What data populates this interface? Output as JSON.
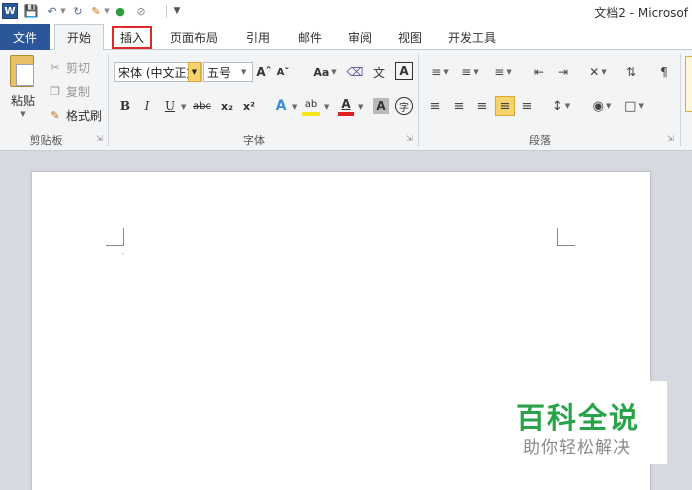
{
  "app": {
    "logo_letter": "W",
    "window_title": "文档2 - Microsof",
    "accent": "#2b579a",
    "highlight_box_color": "#e02828"
  },
  "quick_access": {
    "save_icon": "save-icon",
    "undo_icon": "undo-icon",
    "redo_icon": "redo-icon",
    "format_painter_icon": "paintbrush-icon",
    "color_icon": "color-icon",
    "clear_icon": "no-format-icon",
    "customize_icon": "chevron-down-icon"
  },
  "tabs": [
    {
      "label": "文件"
    },
    {
      "label": "开始"
    },
    {
      "label": "插入"
    },
    {
      "label": "页面布局"
    },
    {
      "label": "引用"
    },
    {
      "label": "邮件"
    },
    {
      "label": "审阅"
    },
    {
      "label": "视图"
    },
    {
      "label": "开发工具"
    }
  ],
  "ribbon": {
    "clipboard": {
      "label": "剪贴板",
      "paste": "粘贴",
      "cut": "剪切",
      "copy": "复制",
      "format_painter": "格式刷"
    },
    "font": {
      "label": "字体",
      "font_name": "宋体 (中文正文",
      "font_size": "五号",
      "case": "Aa",
      "bold": "B",
      "italic": "I",
      "underline": "U",
      "strike": "abc",
      "subscript": "x₂",
      "superscript": "x²",
      "text_effect": "A",
      "highlight": "ab",
      "font_color": "A",
      "char_shading": "A",
      "char_border": "A",
      "enclosed": "字",
      "phonetic": "wén",
      "highlight_color": "#f5e51a",
      "font_color_value": "#e02020"
    },
    "paragraph": {
      "label": "段落"
    }
  },
  "watermark": {
    "title": "百科全说",
    "subtitle": "助你轻松解决",
    "title_color": "#2aa24a"
  }
}
